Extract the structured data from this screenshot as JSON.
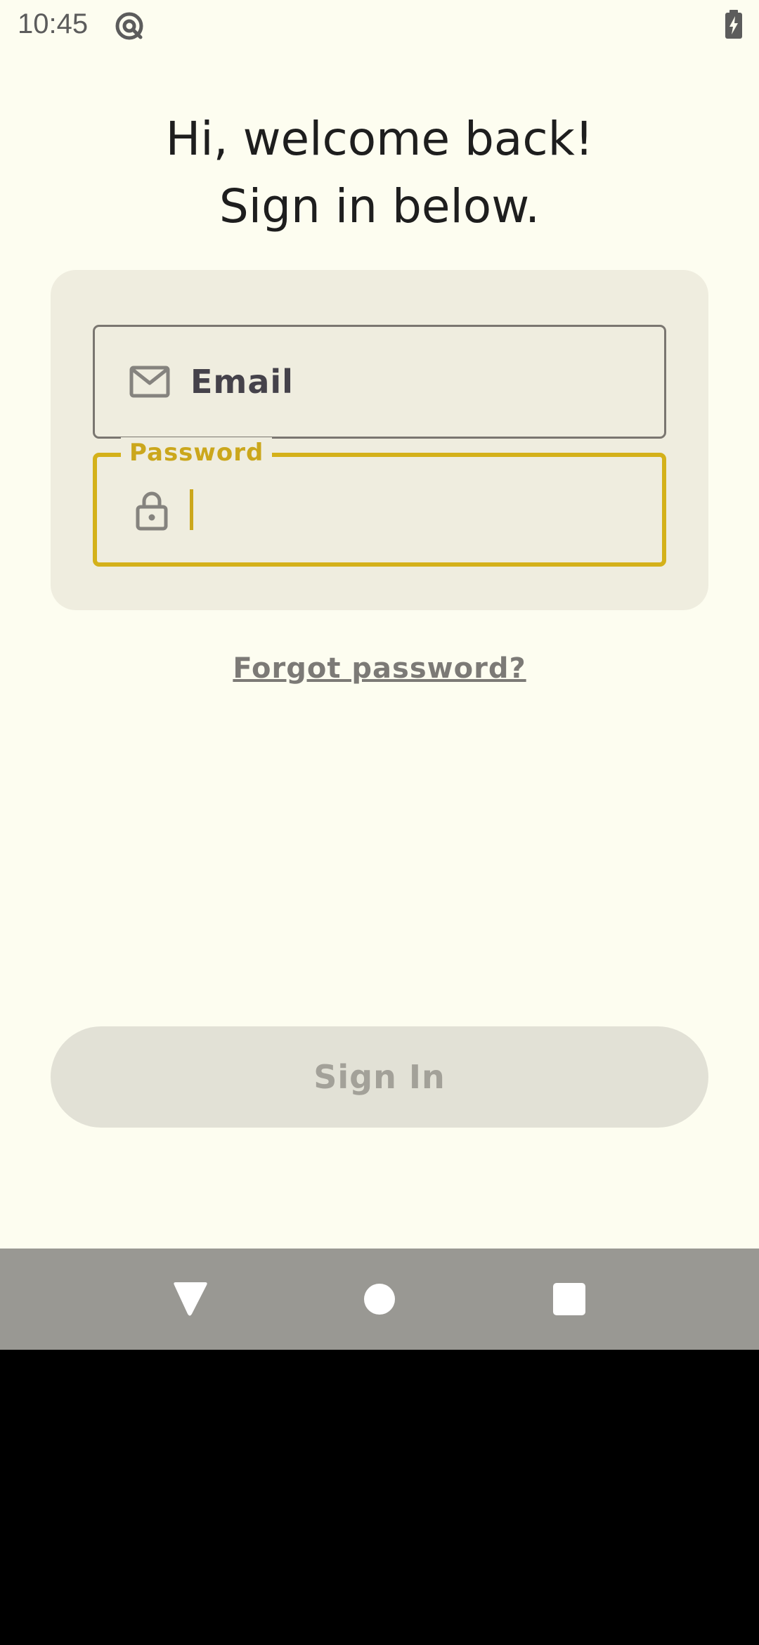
{
  "status_bar": {
    "time": "10:45",
    "app_icon": "at-sign-circle-icon",
    "battery_icon": "battery-charging-icon"
  },
  "headline": {
    "line1": "Hi, welcome back!",
    "line2": "Sign in below."
  },
  "form": {
    "email": {
      "label": "Email",
      "value": "",
      "icon": "mail-icon"
    },
    "password": {
      "label": "Password",
      "value": "",
      "icon": "lock-icon",
      "focused": true
    }
  },
  "forgot_password_link": "Forgot password?",
  "sign_in_button": {
    "label": "Sign In",
    "enabled": false
  },
  "nav_bar": {
    "back_icon": "back-triangle-icon",
    "home_icon": "home-circle-icon",
    "recents_icon": "recents-square-icon"
  },
  "colors": {
    "background": "#FDFDF0",
    "card": "#EFEDDF",
    "accent": "#D4B11A",
    "text_primary": "#1E1E1E",
    "button_disabled": "#E2E1D6",
    "nav_bar": "#999893"
  }
}
